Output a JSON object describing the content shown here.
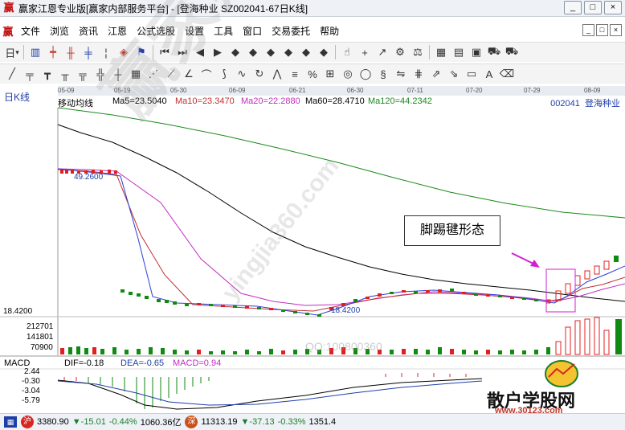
{
  "window": {
    "title": "赢家江恩专业版[赢家内部服务平台] - [登海种业  SZ002041-67日K线]",
    "logo_text": "赢",
    "buttons": [
      "_",
      "□",
      "×"
    ]
  },
  "menu": {
    "logo_text": "赢",
    "items": [
      "文件",
      "浏览",
      "资讯",
      "江恩",
      "公式选股",
      "设置",
      "工具",
      "窗口",
      "交易委托",
      "帮助"
    ],
    "mdi_buttons": [
      "_",
      "□",
      "×"
    ]
  },
  "toolbar": {
    "period_label": "日",
    "dropdown_caret": "▾"
  },
  "date_axis": [
    "05-09",
    "05-19",
    "05-30",
    "06-09",
    "06-21",
    "06-30",
    "07-11",
    "07-20",
    "07-29",
    "08-09"
  ],
  "chart_header": {
    "chart_type_label": "日K线",
    "indicator": "移动均线",
    "ma5": "Ma5=23.5040",
    "ma10": "Ma10=23.3470",
    "ma20": "Ma20=22.2880",
    "ma60": "Ma60=28.4710",
    "ma120": "Ma120=44.2342",
    "stock_code": "002041",
    "stock_name": "登海种业"
  },
  "price_labels": {
    "high_mark": "49.2600",
    "low_mark": "18.4200",
    "low_mark_axis": "18.4200"
  },
  "volume_axis": [
    "212701",
    "141801",
    "70900"
  ],
  "annotation": "脚踢毽形态",
  "macd": {
    "label": "MACD",
    "dif": "DIF=-0.18",
    "dea": "DEA=-0.65",
    "macd": "MACD=0.94",
    "axis": [
      "2.44",
      "-0.30",
      "-3.04",
      "-5.79"
    ]
  },
  "status": {
    "sh_badge": "沪",
    "sh_index": "3380.90",
    "sh_change": "▼-15.01",
    "sh_pct": "-0.44%",
    "sh_amount": "1060.36亿",
    "sz_badge": "深",
    "sz_index": "11313.19",
    "sz_change": "▼-37.13",
    "sz_pct": "-0.33%",
    "sz_amount": "1351.4"
  },
  "watermark": {
    "main": "赢家财富网",
    "site": "yingjia360.com",
    "qq": "QQ:100800360"
  },
  "site_logo": {
    "name": "散户学股网",
    "url": "www.30123.com"
  },
  "colors": {
    "ma5": "#2a3fd6",
    "ma10": "#c03030",
    "ma20": "#c02fc0",
    "ma60": "#000000",
    "ma120": "#1a8a1a",
    "up": "#e02020",
    "down": "#108a10",
    "annotation_arrow": "#d020d0"
  }
}
